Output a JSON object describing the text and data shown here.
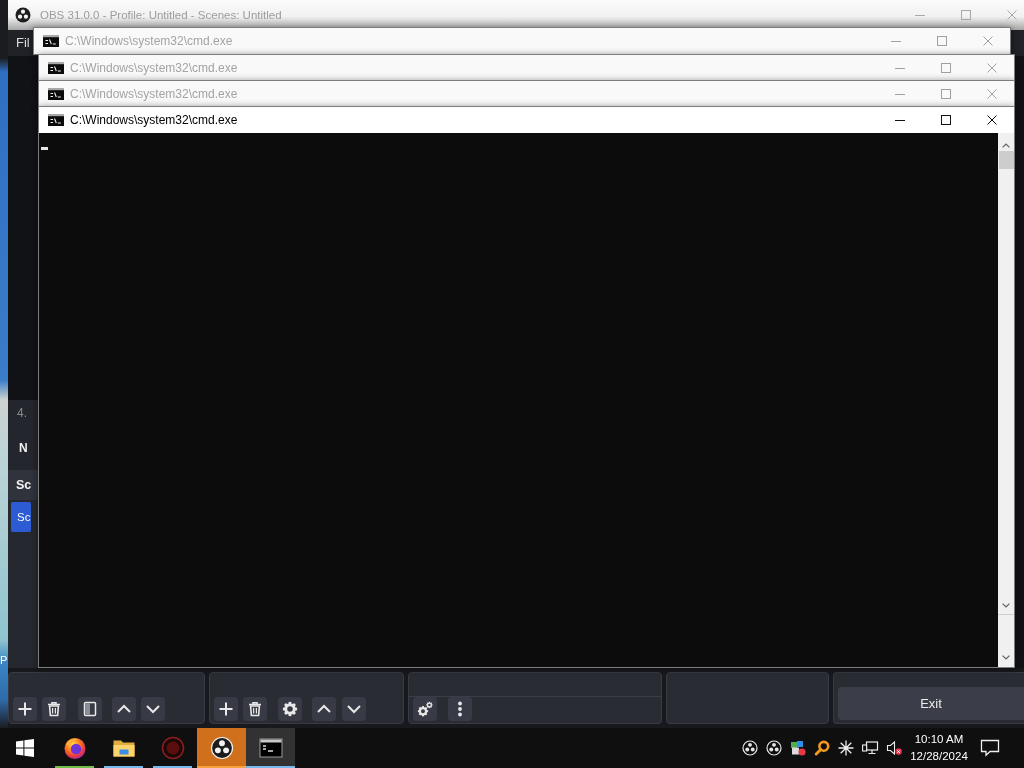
{
  "obs_window": {
    "title": "OBS 31.0.0 - Profile: Untitled - Scenes: Untitled",
    "menu": [
      "Fil"
    ],
    "side_labels": [
      {
        "label": "4.",
        "dimmed": true
      },
      {
        "label": "N",
        "dimmed": false
      }
    ],
    "scenes_dock": {
      "title": "Sc",
      "scenes": [
        {
          "label": "Sc",
          "selected": true
        }
      ]
    },
    "controls_dock": {
      "buttons": [
        "Exit"
      ]
    }
  },
  "console_windows": [
    {
      "title": "C:\\Windows\\system32\\cmd.exe",
      "active": false
    },
    {
      "title": "C:\\Windows\\system32\\cmd.exe",
      "active": false
    },
    {
      "title": "C:\\Windows\\system32\\cmd.exe",
      "active": false
    },
    {
      "title": "C:\\Windows\\system32\\cmd.exe",
      "active": true
    }
  ],
  "desktop": {
    "icon_label": "P"
  },
  "taskbar": {
    "apps": [
      {
        "kind": "browser",
        "color": "#6fbf4a",
        "active": false,
        "flashing": false
      },
      {
        "kind": "folder",
        "color": "#76b9ed",
        "active": false,
        "flashing": false
      },
      {
        "kind": "disc",
        "color": "#76b9ed",
        "active": false,
        "flashing": false
      },
      {
        "kind": "streaming",
        "color": "#f7a23c",
        "active": false,
        "flashing": true
      },
      {
        "kind": "terminal",
        "color": "#76b9ed",
        "active": true,
        "flashing": false
      }
    ],
    "tray": {
      "volume_muted": true
    },
    "clock": {
      "time": "10:10 AM",
      "date": "12/28/2024"
    }
  }
}
